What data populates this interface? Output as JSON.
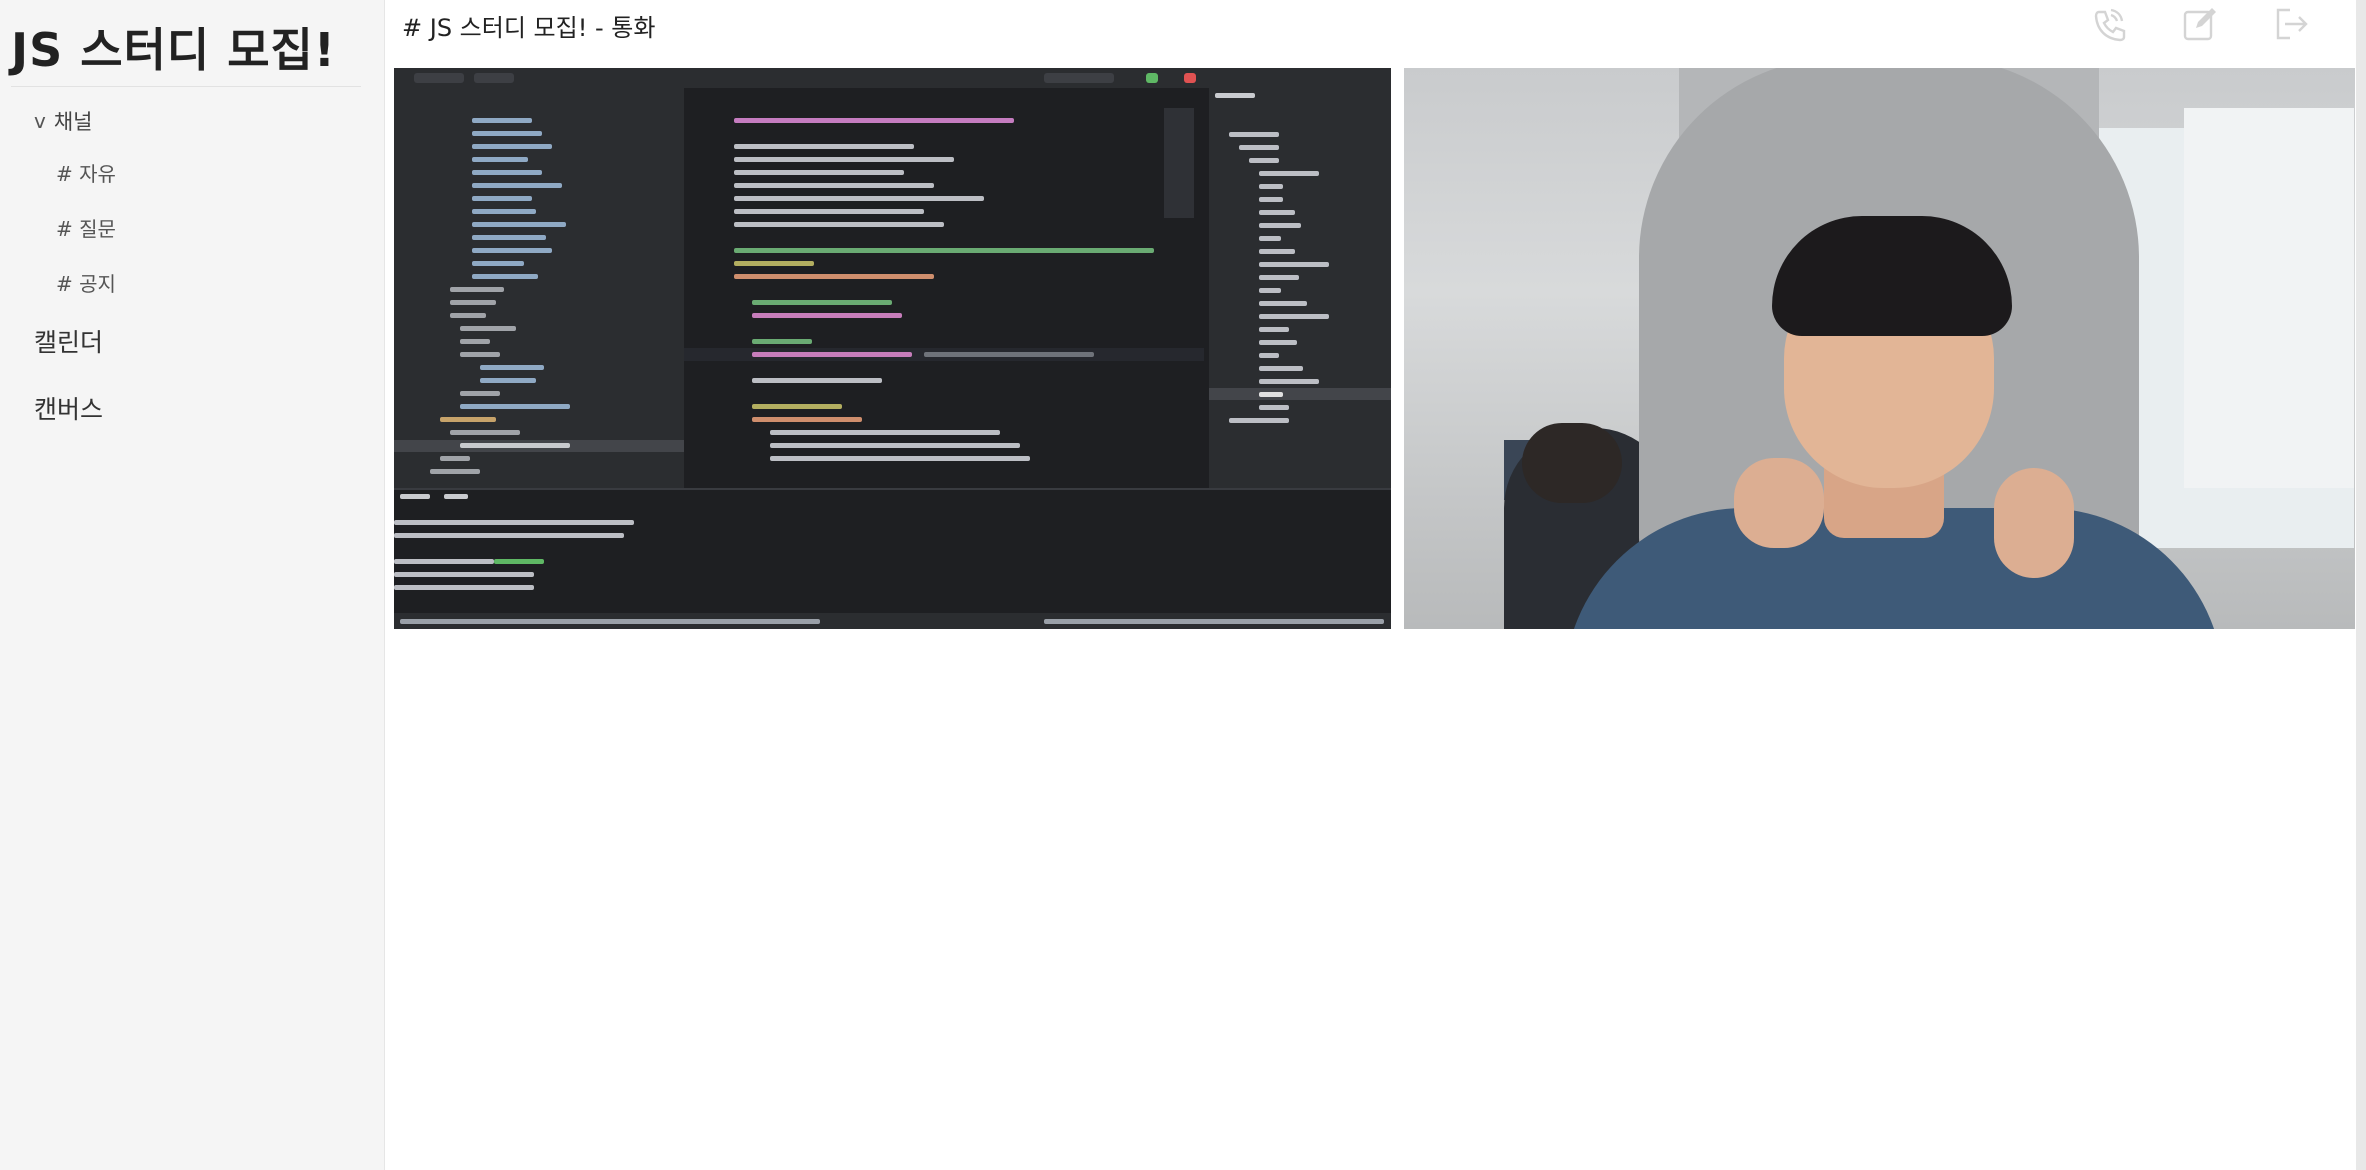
{
  "sidebar": {
    "study_title": "JS 스터디 모집!",
    "channel_section": {
      "toggle": "v",
      "label": "채널"
    },
    "channels": [
      "# 자유",
      "# 질문",
      "# 공지"
    ],
    "nav": [
      "캘린더",
      "캔버스"
    ]
  },
  "header": {
    "title": "# JS 스터디 모집! - 통화",
    "icons": [
      "phone-call-icon",
      "edit-icon",
      "exit-icon"
    ]
  },
  "videos": [
    {
      "kind": "screen-share",
      "description_icon": "ide-screen-share"
    },
    {
      "kind": "camera",
      "description_icon": "webcam-feed"
    }
  ],
  "colors": {
    "sidebar_bg": "#f5f5f5",
    "icon_gray": "#d4d4d4",
    "text": "#222222"
  }
}
